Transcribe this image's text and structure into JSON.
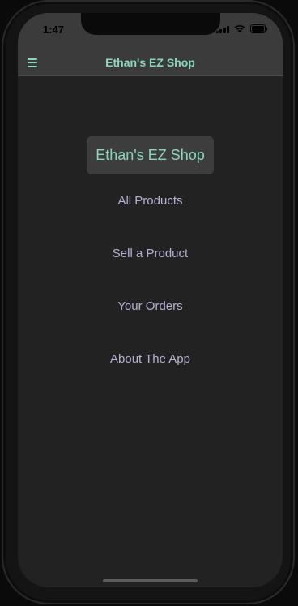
{
  "status_bar": {
    "time": "1:47"
  },
  "header": {
    "title": "Ethan's EZ Shop",
    "menu_icon": "hamburger-menu-icon"
  },
  "main": {
    "shop_title": "Ethan's EZ Shop",
    "nav_links": [
      {
        "label": "All Products"
      },
      {
        "label": "Sell a Product"
      },
      {
        "label": "Your Orders"
      },
      {
        "label": "About The App"
      }
    ]
  },
  "colors": {
    "accent": "#88d8bf",
    "link": "#b5b2d3",
    "background": "#222222",
    "header": "#3b3b3b"
  }
}
